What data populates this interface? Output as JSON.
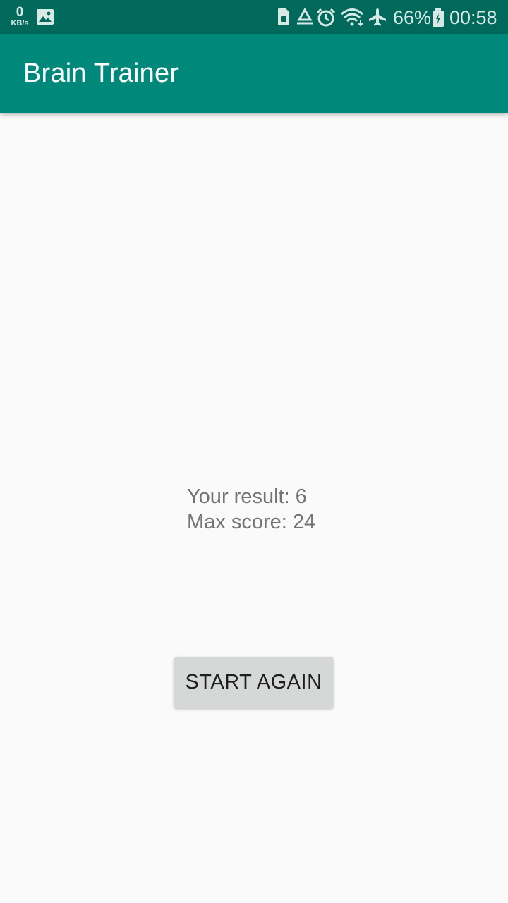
{
  "status_bar": {
    "net_speed_value": "0",
    "net_speed_unit": "KB/s",
    "battery_percent": "66%",
    "time": "00:58",
    "icons": [
      "image-icon",
      "sim-card-icon",
      "recycle-icon",
      "alarm-icon",
      "wifi-icon",
      "airplane-mode-icon",
      "battery-icon"
    ]
  },
  "app_bar": {
    "title": "Brain Trainer"
  },
  "result": {
    "your_result": "Your result: 6",
    "max_score": "Max score: 24"
  },
  "actions": {
    "start_again_label": "START AGAIN"
  },
  "colors": {
    "status_bar": "#00695c",
    "app_bar": "#00897b",
    "background": "#fafafa",
    "button": "#d6d7d7"
  }
}
